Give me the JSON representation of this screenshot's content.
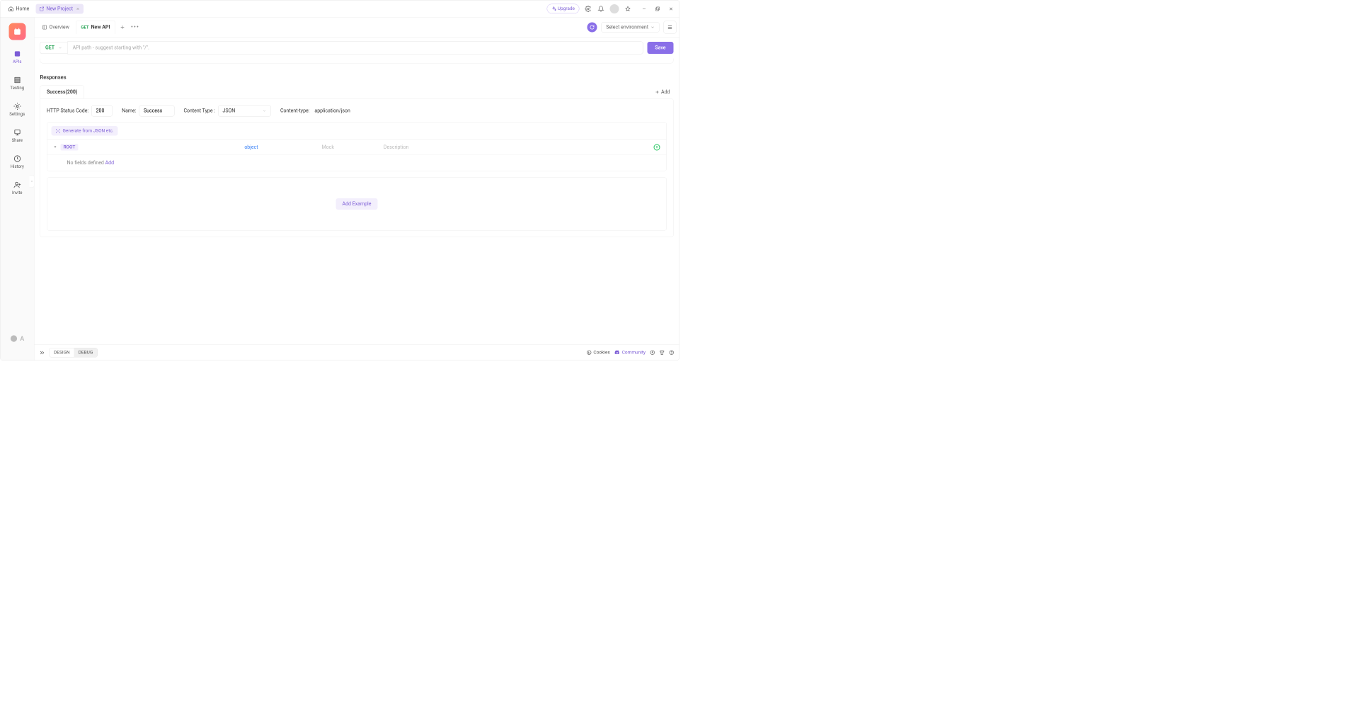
{
  "titlebar": {
    "home": "Home",
    "project_tab": "New Project",
    "upgrade": "Upgrade"
  },
  "leftnav": {
    "apis": "APIs",
    "testing": "Testing",
    "settings": "Settings",
    "share": "Share",
    "history": "History",
    "invite": "Invite",
    "brand_prefix": "A"
  },
  "editor_tabs": {
    "overview": "Overview",
    "active_method": "GET",
    "active_name": "New API",
    "env_placeholder": "Select environment"
  },
  "pathbar": {
    "method": "GET",
    "placeholder": "API path - suggest starting with \"/\".",
    "save": "Save"
  },
  "responses": {
    "heading": "Responses",
    "tab_label": "Success(200)",
    "add": "Add",
    "status_label": "HTTP Status Code:",
    "status_value": "200",
    "name_label": "Name:",
    "name_value": "Success",
    "content_type_label": "Content Type :",
    "content_type_value": "JSON",
    "header_label": "Content-type:",
    "header_value": "application/json",
    "generate": "Generate from JSON etc.",
    "root": "ROOT",
    "root_type": "object",
    "mock": "Mock",
    "description": "Description",
    "no_fields": "No fields defined ",
    "add_field": "Add",
    "add_example": "Add Example"
  },
  "bottombar": {
    "design": "DESIGN",
    "debug": "DEBUG",
    "cookies": "Cookies",
    "community": "Community"
  }
}
